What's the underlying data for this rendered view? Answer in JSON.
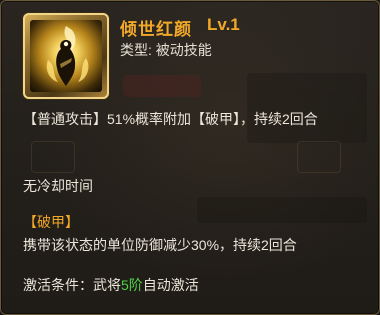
{
  "skill": {
    "name": "倾世红颜",
    "level": "Lv.1",
    "type_label": "类型:",
    "type_value": "被动技能",
    "icon": "flame-figure-icon"
  },
  "description": {
    "main": "【普通攻击】51%概率附加【破甲】，持续2回合",
    "cooldown": "无冷却时间"
  },
  "status_effect": {
    "name": "【破甲】",
    "description": "携带该状态的单位防御减少30%，持续2回合"
  },
  "activation": {
    "prefix": "激活条件：武将",
    "highlight": "5阶",
    "suffix": "自动激活"
  },
  "colors": {
    "title": "#f2a928",
    "text": "#ece6da",
    "highlight": "#4fd24a",
    "border": "#6b5a3a",
    "background": "#24201b"
  }
}
